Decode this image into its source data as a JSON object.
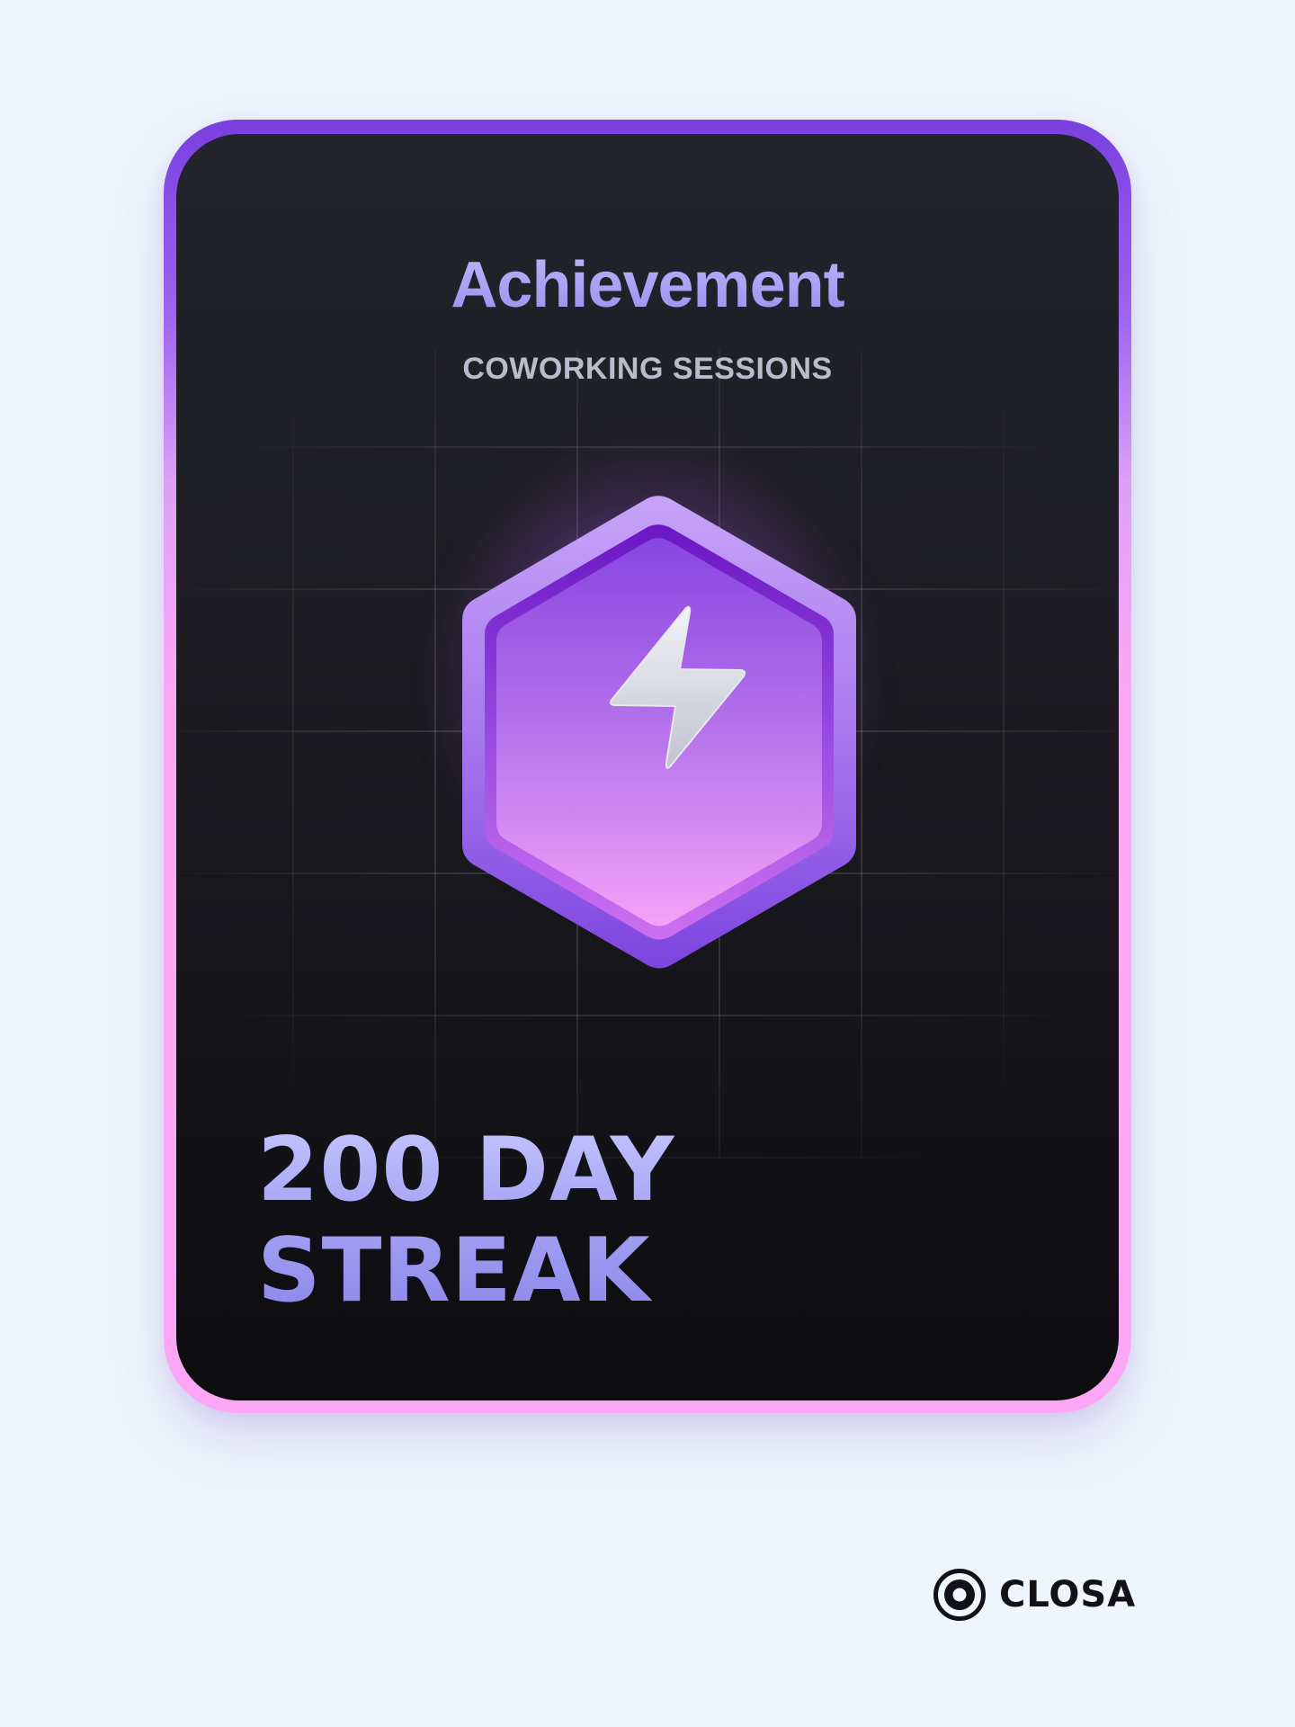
{
  "card": {
    "title": "Achievement",
    "subtitle": "COWORKING SESSIONS",
    "streak_line1": "200 DAY",
    "streak_line2": "STREAK",
    "badge_icon": "lightning-bolt-icon"
  },
  "brand": {
    "name": "CLOSA",
    "logo_icon": "closa-logo-icon"
  },
  "colors": {
    "page_background": "#eef5fd",
    "card_border_top": "#7b3fe0",
    "card_border_bottom": "#fba7f6",
    "card_background": "#1c1c22",
    "title_color": "#a9a3f3",
    "subtitle_color": "#b9bccb",
    "badge_purple": "#8a4de6",
    "badge_pink": "#f0a2f6"
  }
}
